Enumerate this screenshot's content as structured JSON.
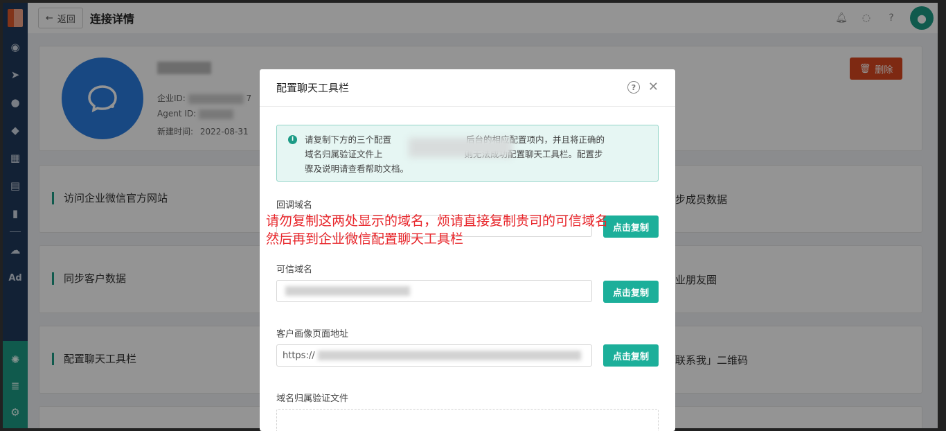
{
  "header": {
    "back_label": "返回",
    "title": "连接详情",
    "icons": [
      "bell-icon",
      "chat-icon",
      "help-icon",
      "user-avatar"
    ]
  },
  "sidebar": {
    "icons": [
      "dashboard-icon",
      "send-icon",
      "user-icon",
      "users-icon",
      "grid-icon",
      "layers-icon",
      "chart-icon",
      "wechat-icon",
      "ad-icon",
      "hub-icon",
      "server-icon",
      "settings-icon"
    ],
    "ad_label": "Ad"
  },
  "info": {
    "corp_id_label": "企业ID:",
    "corp_id_suffix": "7",
    "agent_id_label": "Agent ID:",
    "created_label": "新建时间:",
    "created_value": "2022-08-31",
    "delete_label": "删除"
  },
  "rows": {
    "left": [
      "访问企业微信官方网站",
      "同步客户数据",
      "配置聊天工具栏"
    ],
    "right": [
      "步成员数据",
      "业朋友圈",
      "联系我」二维码"
    ]
  },
  "modal": {
    "title": "配置聊天工具栏",
    "notice": "请复制下方的三个配置项粘贴至企业微信后台的相应配置项内，并且将正确的域名归属验证文件上传，否则无法成功配置聊天工具栏。配置步骤及说明请查看帮助文档。",
    "notice_line1": "请复制下方的三个配置",
    "notice_line1b": "后台的相应配置项内，并且将正确的",
    "notice_line2": "域名归属验证文件上",
    "notice_line2b": "则无法成功配置聊天工具栏。配置步",
    "notice_line3": "骤及说明请查看帮助文档。",
    "fields": [
      {
        "label": "回调域名",
        "value": "",
        "button": "点击复制"
      },
      {
        "label": "可信域名",
        "value": "",
        "button": "点击复制"
      },
      {
        "label": "客户画像页面地址",
        "value": "https://",
        "button": "点击复制"
      }
    ],
    "upload_label": "域名归属验证文件"
  },
  "annotation": {
    "line1": "请勿复制这两处显示的域名，烦请直接复制贵司的可信域名",
    "line2": "然后再到企业微信配置聊天工具栏"
  },
  "colors": {
    "primary": "#1caf9a",
    "danger": "#d9471f",
    "sidebar": "#1f3a5c",
    "annotation": "#e8262b"
  }
}
